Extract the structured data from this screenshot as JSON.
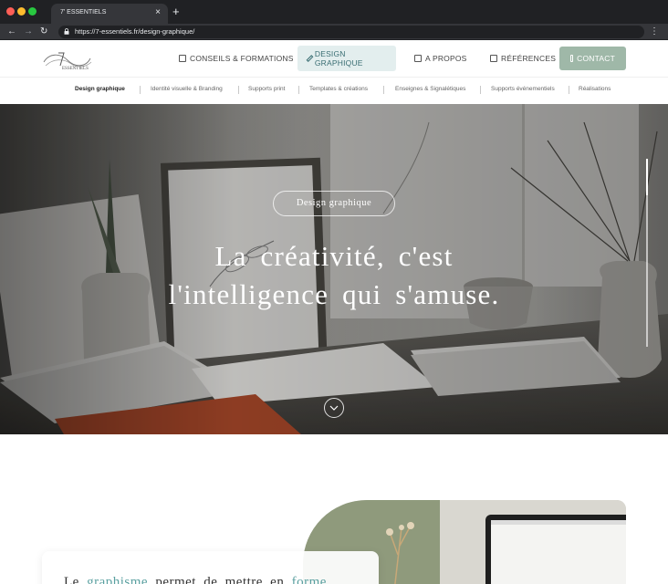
{
  "browser": {
    "tab_title": "7' ESSENTIELS",
    "tab_close": "×",
    "new_tab": "+",
    "url": "https://7-essentiels.fr/design-graphique/",
    "back": "←",
    "forward": "→",
    "reload": "↻",
    "menu": "⋮"
  },
  "header": {
    "logo_alt": "7' Essentiels logo",
    "nav": [
      {
        "label": "CONSEILS & FORMATIONS",
        "icon": "book-icon"
      },
      {
        "label": "DESIGN GRAPHIQUE",
        "icon": "pen-icon",
        "active": true
      },
      {
        "label": "A PROPOS",
        "icon": "user-icon"
      },
      {
        "label": "RÉFÉRENCES",
        "icon": "check-icon"
      },
      {
        "label": "CONTACT",
        "icon": "chat-icon"
      }
    ],
    "subnav": [
      {
        "label": "Design graphique",
        "active": true
      },
      {
        "label": "Identité visuelle & Branding"
      },
      {
        "label": "Supports print"
      },
      {
        "label": "Templates & créations"
      },
      {
        "label": "Enseignes & Signalétiques"
      },
      {
        "label": "Supports événementiels"
      },
      {
        "label": "Réalisations"
      }
    ]
  },
  "hero": {
    "badge": "Design graphique",
    "title_line1": "La créativité, c'est",
    "title_line2": "l'intelligence qui s'amuse.",
    "scroll_icon": "chevron-down-icon"
  },
  "section2": {
    "text_before": "Le ",
    "highlight1": "graphisme",
    "text_middle": " permet de mettre en ",
    "highlight2": "forme"
  },
  "colors": {
    "accent": "#3a6e73",
    "contact_bg": "#9fb8a8",
    "active_nav_bg": "#e3eeee",
    "highlight": "#5aa0a0"
  }
}
